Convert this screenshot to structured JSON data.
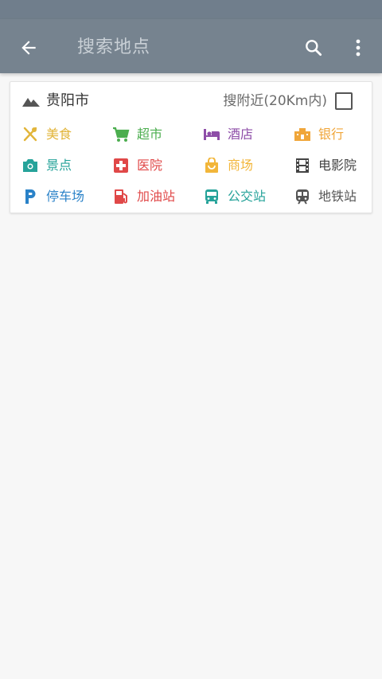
{
  "appbar": {
    "back_icon": "arrow-left-icon",
    "placeholder": "搜索地点",
    "search_icon": "search-icon",
    "more_icon": "more-vertical-icon",
    "background": "#76838f"
  },
  "city_card": {
    "city_icon": "mountain-icon",
    "city": "贵阳市",
    "nearby_label": "搜附近(20Km内)",
    "nearby_checked": false
  },
  "categories": [
    {
      "label": "美食",
      "icon": "utensils-icon",
      "color": "#e2b53a"
    },
    {
      "label": "超市",
      "icon": "shopping-cart-icon",
      "color": "#4cae4f"
    },
    {
      "label": "酒店",
      "icon": "hotel-bed-icon",
      "color": "#8e4ea8"
    },
    {
      "label": "银行",
      "icon": "bank-icon",
      "color": "#f0a63a"
    },
    {
      "label": "景点",
      "icon": "camera-icon",
      "color": "#26a39a"
    },
    {
      "label": "医院",
      "icon": "hospital-cross-icon",
      "color": "#e04848"
    },
    {
      "label": "商场",
      "icon": "shopping-bag-icon",
      "color": "#f2b63a"
    },
    {
      "label": "电影院",
      "icon": "film-icon",
      "color": "#444444"
    },
    {
      "label": "停车场",
      "icon": "parking-icon",
      "color": "#2a82c8"
    },
    {
      "label": "加油站",
      "icon": "gas-station-icon",
      "color": "#e04848"
    },
    {
      "label": "公交站",
      "icon": "bus-icon",
      "color": "#26a39a"
    },
    {
      "label": "地铁站",
      "icon": "subway-icon",
      "color": "#555555"
    }
  ]
}
